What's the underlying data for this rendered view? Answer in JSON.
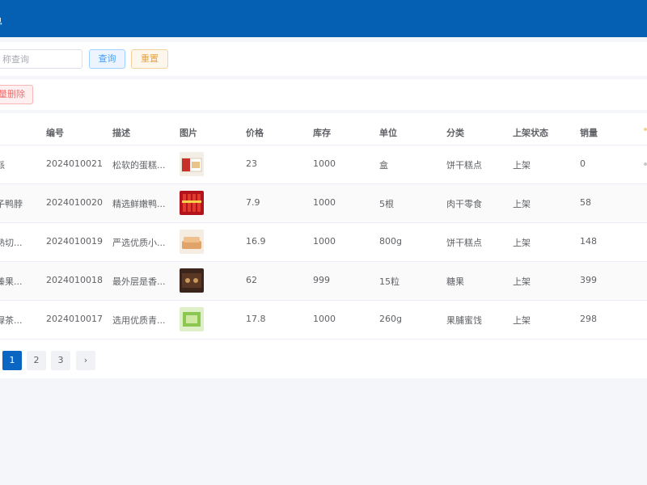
{
  "header": {
    "title": "息"
  },
  "search": {
    "placeholder": "称查询",
    "query_label": "查询",
    "reset_label": "重置"
  },
  "toolbar": {
    "batch_delete_label": "批量删除"
  },
  "table": {
    "columns": {
      "name": "",
      "code": "编号",
      "desc": "描述",
      "image": "图片",
      "price": "价格",
      "stock": "库存",
      "unit": "单位",
      "category": "分类",
      "status": "上架状态",
      "sales": "销量"
    },
    "rows": [
      {
        "name": "金派",
        "code": "2024010021",
        "desc": "松软的蛋糕...",
        "price": "23",
        "stock": "1000",
        "unit": "盒",
        "category": "饼干糕点",
        "status": "上架",
        "sales": "0",
        "thumb": "cake-box"
      },
      {
        "name": "筒子鸭脖",
        "code": "2024010020",
        "desc": "精选鲜嫩鸭...",
        "price": "7.9",
        "stock": "1000",
        "unit": "5根",
        "category": "肉干零食",
        "status": "上架",
        "sales": "58",
        "thumb": "duck-neck"
      },
      {
        "name": "鸡熟切...",
        "code": "2024010019",
        "desc": "严选优质小...",
        "price": "16.9",
        "stock": "1000",
        "unit": "800g",
        "category": "饼干糕点",
        "status": "上架",
        "sales": "148",
        "thumb": "bread"
      },
      {
        "name": "伊榛果...",
        "code": "2024010018",
        "desc": "最外层是香...",
        "price": "62",
        "stock": "999",
        "unit": "15粒",
        "category": "糖果",
        "status": "上架",
        "sales": "399",
        "thumb": "chocolate"
      },
      {
        "name": "抹绿茶...",
        "code": "2024010017",
        "desc": "选用优质青...",
        "price": "17.8",
        "stock": "1000",
        "unit": "260g",
        "category": "果脯蜜饯",
        "status": "上架",
        "sales": "298",
        "thumb": "green-tea"
      }
    ]
  },
  "pagination": {
    "pages": [
      "1",
      "2",
      "3"
    ],
    "next": "›",
    "current": "1"
  },
  "colors": {
    "topbar": "#0560b3",
    "query": "#409eff",
    "reset": "#e6a23c",
    "danger": "#f56c6c",
    "page_active": "#0a66c2"
  }
}
